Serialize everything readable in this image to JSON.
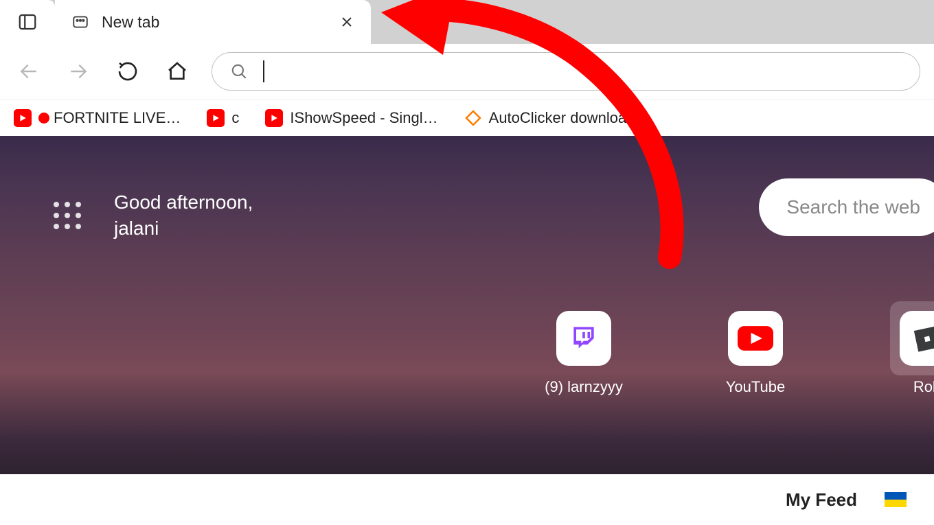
{
  "tab": {
    "title": "New tab"
  },
  "bookmarks": [
    {
      "type": "youtube",
      "label": "FORTNITE LIVE…",
      "live": true
    },
    {
      "type": "youtube",
      "label": "c",
      "live": false
    },
    {
      "type": "youtube",
      "label": "IShowSpeed - Singl…",
      "live": false
    },
    {
      "type": "autoclicker",
      "label": "AutoClicker download…",
      "live": false
    }
  ],
  "greeting": {
    "line1": "Good afternoon,",
    "line2": "jalani"
  },
  "search_web": {
    "placeholder": "Search the web"
  },
  "quick_links": [
    {
      "label": "(9) larnzyyy",
      "icon": "twitch"
    },
    {
      "label": "YouTube",
      "icon": "youtube"
    },
    {
      "label": "Rob",
      "icon": "roblox"
    }
  ],
  "feed": {
    "title": "My Feed"
  }
}
